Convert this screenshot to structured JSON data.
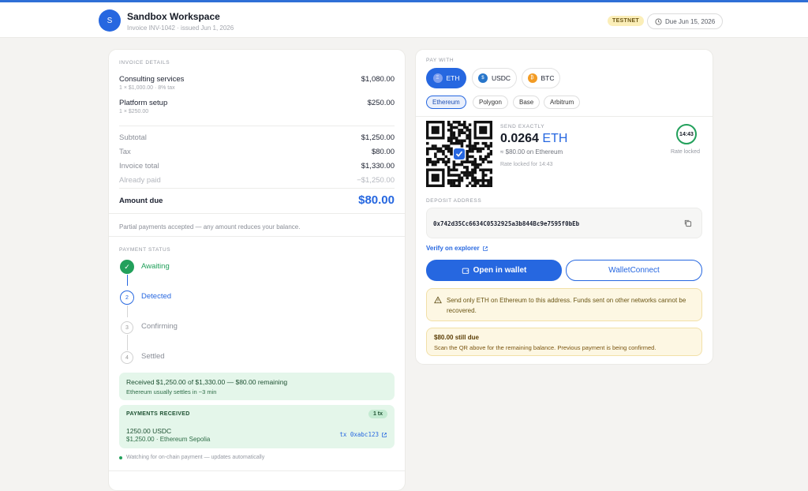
{
  "header": {
    "avatar_letter": "S",
    "workspace_name": "Sandbox Workspace",
    "invoice_meta": "Invoice INV-1042 · issued Jun 1, 2026",
    "network_badge": "TESTNET",
    "due_label": "Due Jun 15, 2026"
  },
  "invoice": {
    "section_label": "INVOICE DETAILS",
    "items": [
      {
        "name": "Consulting services",
        "detail": "1 × $1,000.00 · 8% tax",
        "amount": "$1,080.00"
      },
      {
        "name": "Platform setup",
        "detail": "1 × $250.00",
        "amount": "$250.00"
      }
    ],
    "totals": [
      {
        "label": "Subtotal",
        "value": "$1,250.00"
      },
      {
        "label": "Tax",
        "value": "$80.00"
      },
      {
        "label": "Invoice total",
        "value": "$1,330.00"
      },
      {
        "label": "Already paid",
        "value": "−$1,250.00"
      }
    ],
    "amount_due_label": "Amount due",
    "amount_due_value": "$80.00",
    "partial_note": "Partial payments accepted — any amount reduces your balance."
  },
  "status": {
    "section_label": "PAYMENT STATUS",
    "steps": [
      {
        "number": "✓",
        "label": "Awaiting"
      },
      {
        "number": "2",
        "label": "Detected"
      },
      {
        "number": "3",
        "label": "Confirming"
      },
      {
        "number": "4",
        "label": "Settled"
      }
    ],
    "received_line": "Received $1,250.00 of $1,330.00 — $80.00 remaining",
    "settle_note": "Ethereum usually settles in ~3 min",
    "payments_label": "PAYMENTS RECEIVED",
    "payments_count": "1 tx",
    "payment_amount": "1250.00 USDC",
    "payment_detail": "$1,250.00 · Ethereum Sepolia",
    "payment_tx": "tx 0xabc123",
    "watching_note": "Watching for on-chain payment — updates automatically"
  },
  "pay": {
    "section_label": "PAY WITH",
    "currencies": [
      {
        "symbol": "ETH",
        "glyph": "Ξ",
        "color": "#6d8de8"
      },
      {
        "symbol": "USDC",
        "glyph": "$",
        "color": "#2775ca"
      },
      {
        "symbol": "BTC",
        "glyph": "₿",
        "color": "#f29b24"
      }
    ],
    "networks": [
      "Ethereum",
      "Polygon",
      "Base",
      "Arbitrum"
    ],
    "send_label": "SEND EXACTLY",
    "send_amount": "0.0264",
    "send_unit": "ETH",
    "send_fiat": "≈ $80.00 on Ethereum",
    "rate_note": "Rate locked for 14:43",
    "timer": "14:43",
    "timer_label": "Rate locked",
    "deposit_label": "DEPOSIT ADDRESS",
    "address": "0x742d35Cc6634C0532925a3b844Bc9e7595f0bEb",
    "verify_link": "Verify on explorer",
    "open_wallet": "Open in wallet",
    "walletconnect": "WalletConnect",
    "warning": "Send only ETH on Ethereum to this address. Funds sent on other networks cannot be recovered.",
    "due_title": "$80.00 still due",
    "due_text": "Scan the QR above for the remaining balance. Previous payment is being confirmed.",
    "colors": {
      "accent": "#2667e0",
      "success": "#22a05b",
      "warning_bg": "#fdf7e3"
    }
  }
}
